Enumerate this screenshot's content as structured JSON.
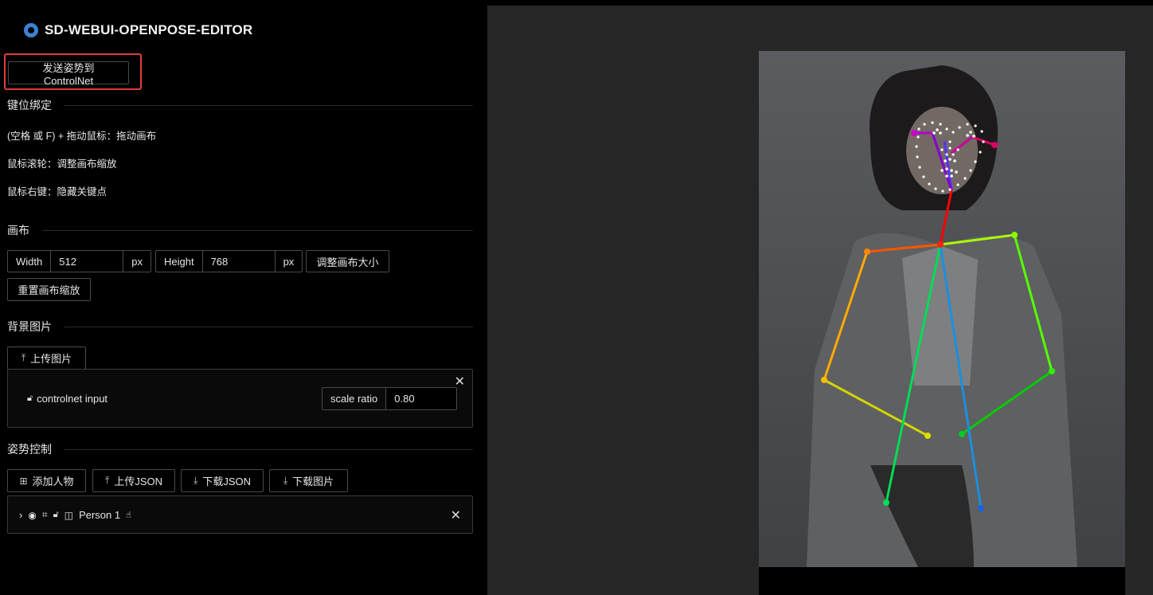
{
  "app": {
    "title": "SD-WEBUI-OPENPOSE-EDITOR"
  },
  "send_button": "发送姿势到ControlNet",
  "keybind": {
    "heading": "键位绑定",
    "lines": [
      "(空格 或 F) + 拖动鼠标：拖动画布",
      "鼠标滚轮：调整画布缩放",
      "鼠标右键：隐藏关键点"
    ]
  },
  "canvas": {
    "heading": "画布",
    "width_label": "Width",
    "width_value": "512",
    "width_unit": "px",
    "height_label": "Height",
    "height_value": "768",
    "height_unit": "px",
    "resize_button": "调整画布大小",
    "reset_zoom_button": "重置画布缩放"
  },
  "background": {
    "heading": "背景图片",
    "upload_button": "上传图片",
    "item_name": "controlnet input",
    "scale_label": "scale ratio",
    "scale_value": "0.80",
    "close": "✕"
  },
  "pose": {
    "heading": "姿势控制",
    "add_person_button": "添加人物",
    "upload_json_button": "上传JSON",
    "download_json_button": "下载JSON",
    "download_image_button": "下载图片",
    "person_name": "Person 1",
    "close": "✕"
  },
  "colors": {
    "highlight": "#e23b3b",
    "github": "#3b82d6"
  }
}
